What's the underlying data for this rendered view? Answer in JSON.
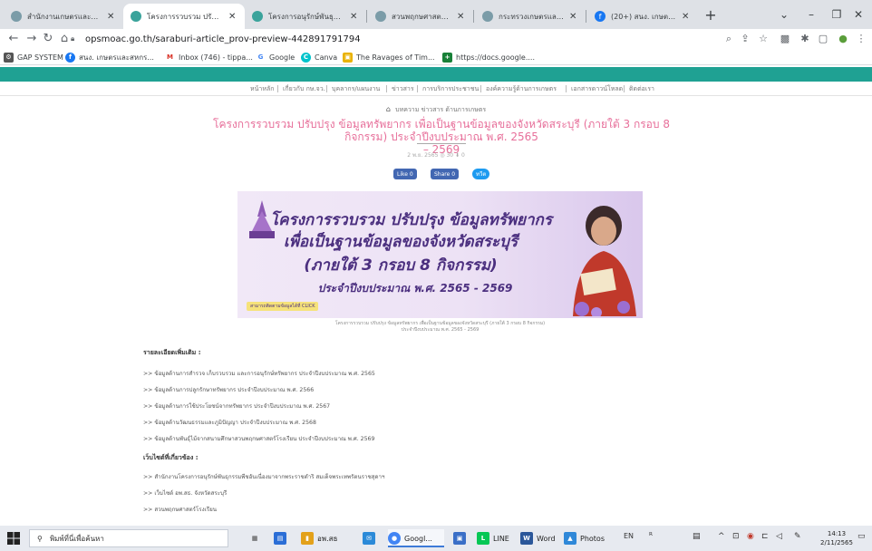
{
  "browser": {
    "tabs": [
      {
        "title": "สำนักงานเกษตรและสหกรณ์",
        "favicon_color": "#7b9ca8",
        "active": false
      },
      {
        "title": "โครงการรวบรวม ปรับปรุง ข้...",
        "favicon_color": "#3aa39b",
        "active": true
      },
      {
        "title": "โครงการอนุรักษ์พันธุกรรมพื...",
        "favicon_color": "#3aa39b",
        "active": false
      },
      {
        "title": "สวนพฤกษศาสตร์โรงเรียน ส...",
        "favicon_color": "#7b9ca8",
        "active": false
      },
      {
        "title": "กระทรวงเกษตรและสหกรณ์",
        "favicon_color": "#7b9ca8",
        "active": false
      },
      {
        "title": "(20+) สนง. เกษตรและสหกร...",
        "favicon_color": "#1877f2",
        "active": false
      }
    ],
    "new_tab": "+",
    "url": "opsmoac.go.th/saraburi-article_prov-preview-442891791794",
    "bookmarks": [
      {
        "label": "GAP SYSTEM",
        "color": "#555555",
        "glyph": "⚙"
      },
      {
        "label": "สนง. เกษตรและสหกร...",
        "color": "#1877f2",
        "glyph": "f"
      },
      {
        "label": "Inbox (746) - tippa...",
        "color": "#d93025",
        "glyph": "M"
      },
      {
        "label": "Google",
        "color": "#4285f4",
        "glyph": "G"
      },
      {
        "label": "Canva",
        "color": "#00c4cc",
        "glyph": "C"
      },
      {
        "label": "The Ravages of Tim...",
        "color": "#e9b200",
        "glyph": "▣"
      },
      {
        "label": "https://docs.google....",
        "color": "#188038",
        "glyph": "+"
      }
    ]
  },
  "site": {
    "nav": [
      "หน้าหลัก",
      "เกี่ยวกับ กษ.จว.",
      "บุคลากร/แผนงาน",
      "ข่าวสาร",
      "การบริการประชาชน",
      "องค์ความรู้ด้านการเกษตร",
      "เอกสารดาวน์โหลด",
      "ติดต่อเรา"
    ],
    "breadcrumb": "บทความ ข่าวสาร ด้านการเกษตร",
    "title_line1": "โครงการรวบรวม ปรับปรุง ข้อมูลทรัพยากร เพื่อเป็นฐานข้อมูลของจังหวัดสระบุรี (ภายใต้ 3 กรอบ 8 กิจกรรม) ประจำปีงบประมาณ พ.ศ. 2565",
    "title_line2": "– 2569",
    "meta": "2 พ.ย. 2565   ◎ 30   ⬇ 0",
    "share": {
      "like": "Like 0",
      "share": "Share 0",
      "tweet": "ทวีต"
    },
    "banner": {
      "line1": "โครงการรวบรวม ปรับปรุง ข้อมูลทรัพยากร",
      "line2": "เพื่อเป็นฐานข้อมูลของจังหวัดสระบุรี",
      "line3": "(ภายใต้ 3 กรอบ 8 กิจกรรม)",
      "line4": "ประจำปีงบประมาณ พ.ศ. 2565 - 2569",
      "tag": "สามารถติดตามข้อมูลได้ที่ CLICK"
    },
    "caption_line1": "โครงการรวบรวม ปรับปรุง ข้อมูลทรัพยากร เพื่อเป็นฐานข้อมูลของจังหวัดสระบุรี (ภายใต้ 3 กรอบ 8 กิจกรรม)",
    "caption_line2": "ประจำปีงบประมาณ พ.ศ. 2565 - 2569",
    "details_heading": "รายละเอียดเพิ่มเติม :",
    "details": [
      ">> ข้อมูลด้านการสำรวจ เก็บรวบรวม และการอนุรักษ์ทรัพยากร ประจำปีงบประมาณ พ.ศ. 2565",
      ">> ข้อมูลด้านการปลูกรักษาทรัพยากร ประจำปีงบประมาณ พ.ศ. 2566",
      ">> ข้อมูลด้านการใช้ประโยชน์จากทรัพยากร ประจำปีงบประมาณ พ.ศ. 2567",
      ">> ข้อมูลด้านวัฒนธรรมและภูมิปัญญา ประจำปีงบประมาณ พ.ศ. 2568",
      ">> ข้อมูลด้านพันธุ์ไม้จากสนามศึกษาสวนพฤกษศาสตร์โรงเรียน ประจำปีงบประมาณ พ.ศ. 2569"
    ],
    "links_heading": "เว็บไซต์ที่เกี่ยวข้อง :",
    "links": [
      ">> สำนักงานโครงการอนุรักษ์พันธุกรรมพืชอันเนื่องมาจากพระราชดำริ สมเด็จพระเทพรัตนราชสุดาฯ",
      ">> เว็บไซต์ อพ.สธ. จังหวัดสระบุรี",
      ">> สวนพฤกษศาสตร์โรงเรียน"
    ]
  },
  "taskbar": {
    "search_placeholder": "พิมพ์ที่นี่เพื่อค้นหา",
    "apps": [
      {
        "label": "",
        "color": "#444444",
        "glyph": "▦"
      },
      {
        "label": "",
        "color": "#2b6ed6",
        "glyph": "▤"
      },
      {
        "label": "อพ.สธ",
        "color": "#e3a11a",
        "glyph": "▮"
      },
      {
        "label": "",
        "color": "#2b8ad8",
        "glyph": "✉"
      },
      {
        "label": "Googl...",
        "color": "#4285f4",
        "glyph": "●"
      },
      {
        "label": "",
        "color": "#3a6fc7",
        "glyph": "▣"
      },
      {
        "label": "LINE",
        "color": "#06c755",
        "glyph": "L"
      },
      {
        "label": "Word",
        "color": "#2b579a",
        "glyph": "W"
      },
      {
        "label": "Photos",
        "color": "#2f88d8",
        "glyph": "▲"
      }
    ],
    "lang": "EN",
    "time": "14:13",
    "date": "2/11/2565"
  }
}
